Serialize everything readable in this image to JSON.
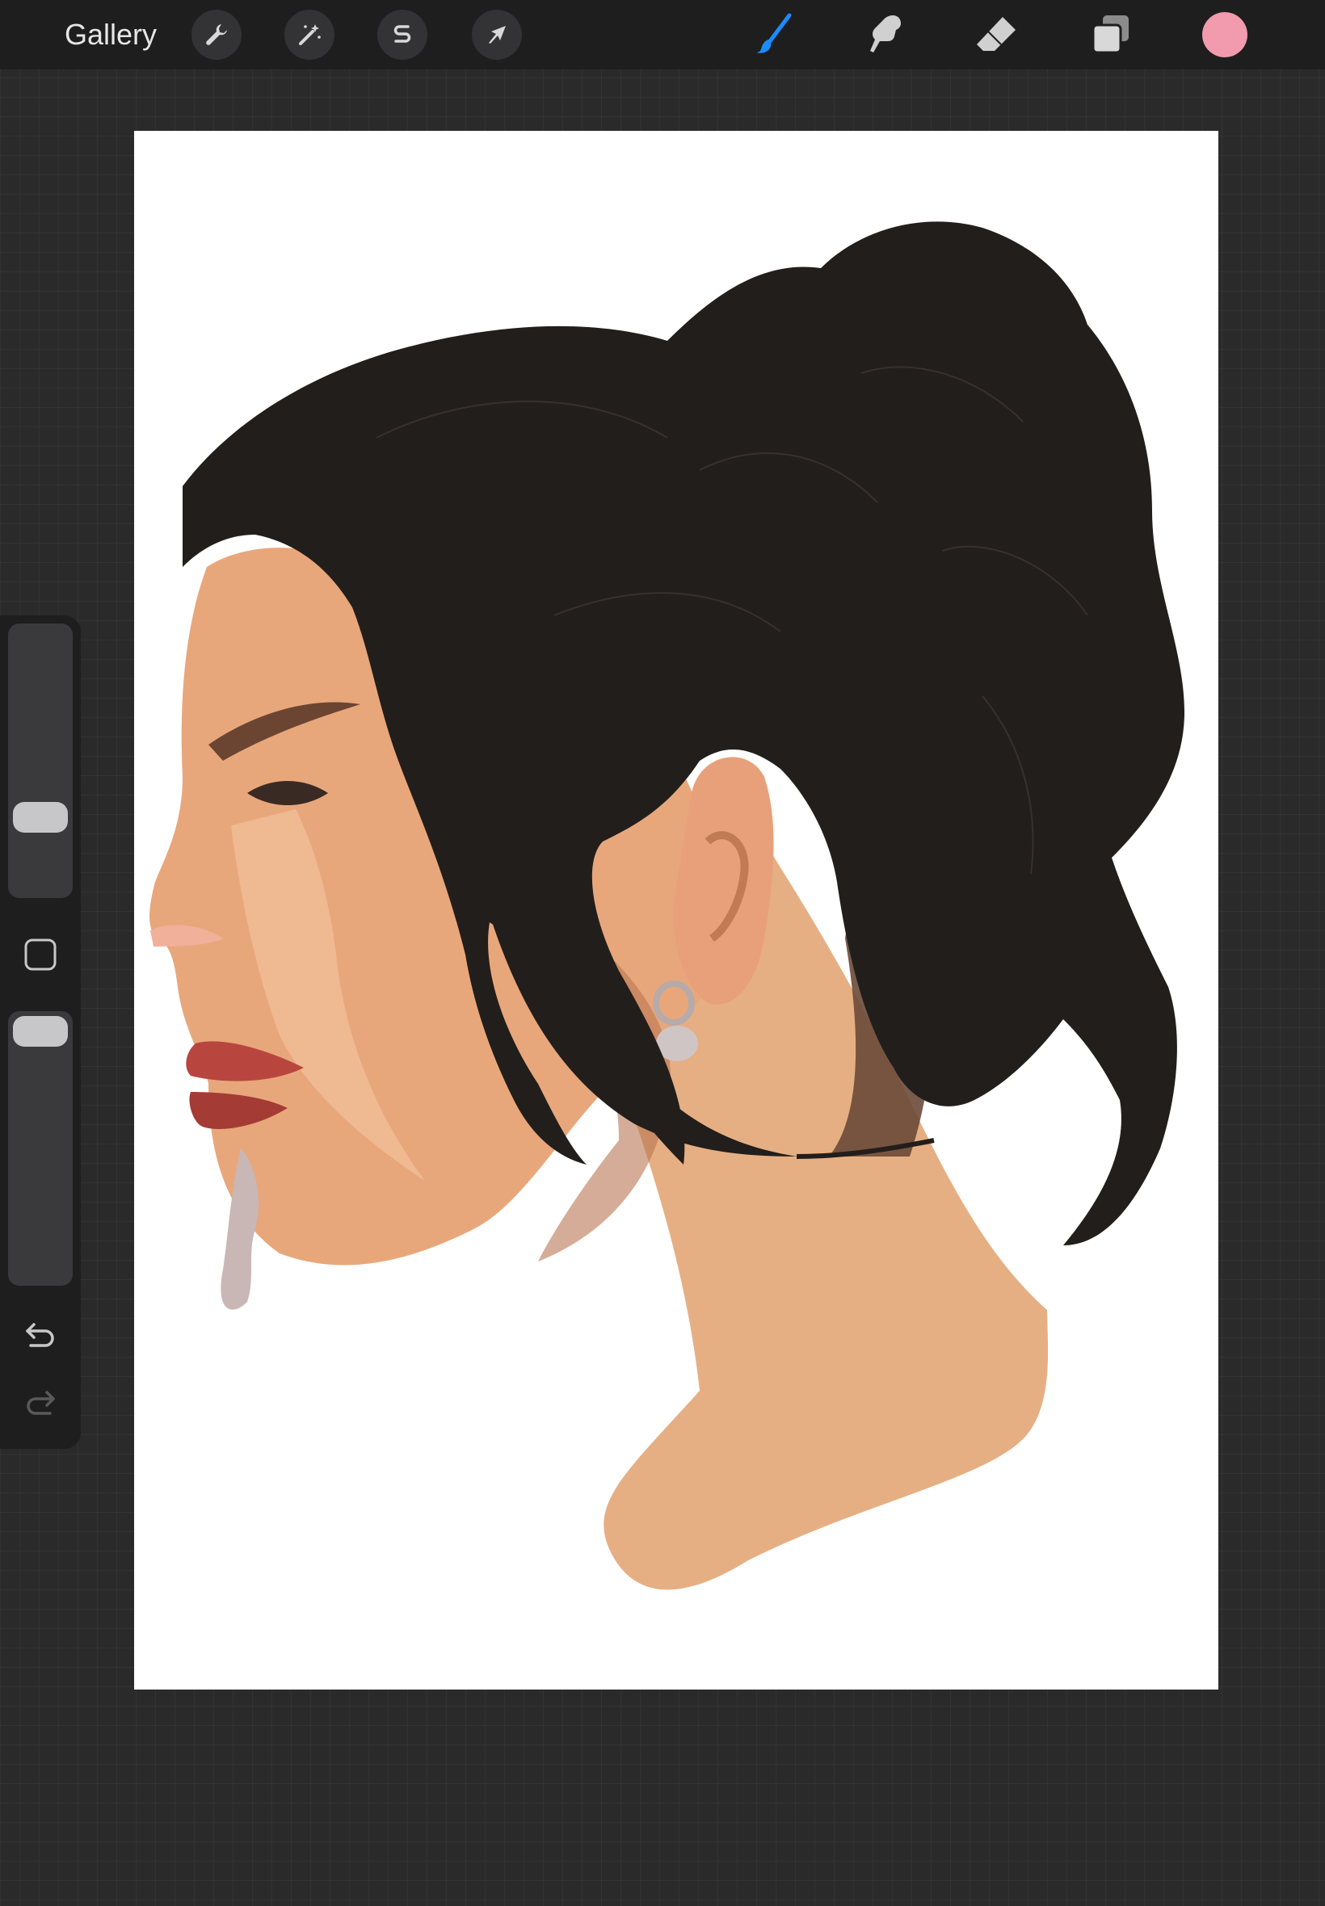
{
  "topbar": {
    "gallery_label": "Gallery",
    "actions": [
      {
        "icon": "wrench-icon",
        "name": "actions-button"
      },
      {
        "icon": "magic-wand-icon",
        "name": "adjustments-button"
      },
      {
        "icon": "selection-s-icon",
        "name": "selection-button"
      },
      {
        "icon": "arrow-cursor-icon",
        "name": "transform-button"
      }
    ],
    "tools": [
      {
        "icon": "brush-icon",
        "name": "paint-tool",
        "active": true
      },
      {
        "icon": "smudge-icon",
        "name": "smudge-tool",
        "active": false
      },
      {
        "icon": "eraser-icon",
        "name": "eraser-tool",
        "active": false
      },
      {
        "icon": "layers-icon",
        "name": "layers-button",
        "active": false
      }
    ],
    "current_color": "#f29bae"
  },
  "sidebar": {
    "brush_size": 0.26,
    "brush_opacity": 1.0,
    "modify_icon": "square-icon",
    "undo_icon": "undo-icon",
    "redo_icon": "redo-icon"
  },
  "colors": {
    "accent_blue": "#1a8cff",
    "hair": "#221e1b",
    "skin": "#e6af83",
    "lips": "#b8463f"
  }
}
